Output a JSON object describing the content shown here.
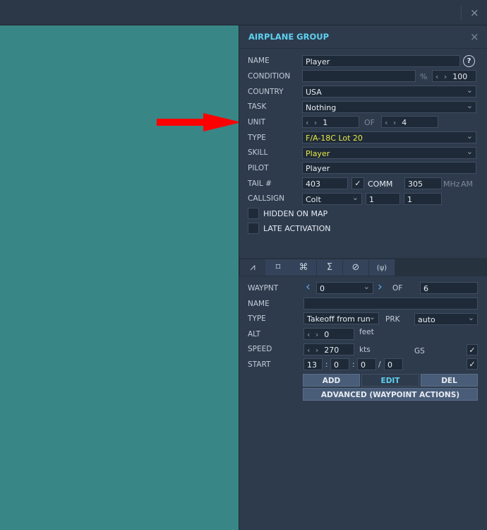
{
  "window": {
    "close_icon": "×"
  },
  "panel": {
    "title": "AIRPLANE GROUP",
    "close_icon": "×"
  },
  "group": {
    "name_label": "NAME",
    "name_value": "Player",
    "help": "?",
    "condition_label": "CONDITION",
    "condition_value": "",
    "percent": "%",
    "condition_pct": "100",
    "country_label": "COUNTRY",
    "country_value": "USA",
    "task_label": "TASK",
    "task_value": "Nothing",
    "unit_label": "UNIT",
    "unit_value": "1",
    "of_label": "OF",
    "unit_total": "4",
    "type_label": "TYPE",
    "type_value": "F/A-18C Lot 20",
    "skill_label": "SKILL",
    "skill_value": "Player",
    "pilot_label": "PILOT",
    "pilot_value": "Player",
    "tail_label": "TAIL #",
    "tail_value": "403",
    "comm_label": "COMM",
    "comm_value": "305",
    "mhz": "MHz",
    "am": "AM",
    "callsign_label": "CALLSIGN",
    "callsign_value": "Colt",
    "callsign_num1": "1",
    "callsign_num2": "1",
    "hidden_label": "HIDDEN ON MAP",
    "late_label": "LATE ACTIVATION"
  },
  "tabs": [
    "route",
    "target",
    "triggered-actions",
    "summary",
    "payload-none",
    "radio"
  ],
  "waypoint": {
    "waypnt_label": "WAYPNT",
    "waypnt_value": "0",
    "of_label": "OF",
    "total": "6",
    "name_label": "NAME",
    "name_value": "",
    "type_label": "TYPE",
    "type_value": "Takeoff from run",
    "prk_label": "PRK",
    "prk_value": "auto",
    "alt_label": "ALT",
    "alt_value": "0",
    "alt_unit": "feet",
    "speed_label": "SPEED",
    "speed_value": "270",
    "speed_unit": "kts",
    "gs_label": "GS",
    "start_label": "START",
    "start_h": "13",
    "start_m": "0",
    "start_s": "0",
    "start_d": "0",
    "sep1": ":",
    "sep2": ":",
    "sep3": "/",
    "add": "ADD",
    "edit": "EDIT",
    "del": "DEL",
    "advanced": "ADVANCED (WAYPOINT ACTIONS)"
  },
  "colors": {
    "map": "#398686",
    "accent": "#5fd0ef",
    "highlight": "#e8e84a",
    "arrow": "#ff0000"
  }
}
